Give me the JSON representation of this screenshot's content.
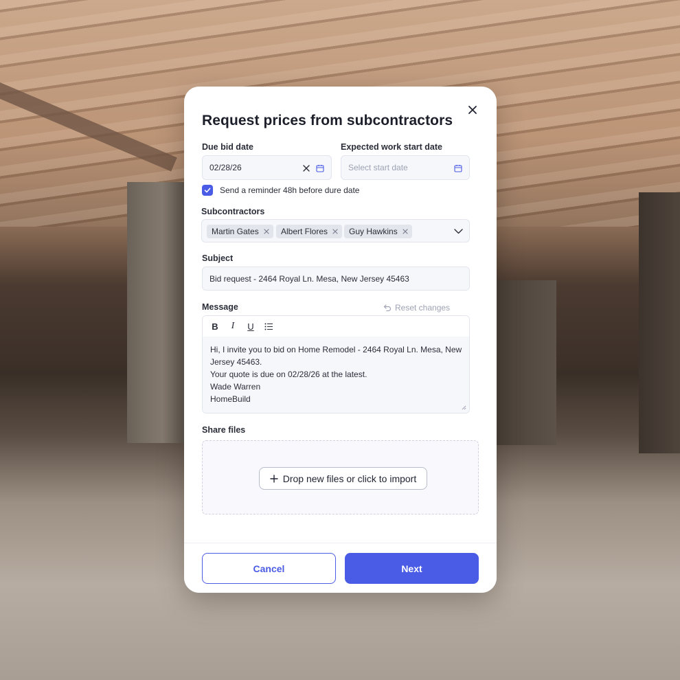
{
  "modal": {
    "title": "Request prices from subcontractors",
    "close_icon": "close-icon"
  },
  "due_bid_date": {
    "label": "Due bid date",
    "value": "02/28/26"
  },
  "work_start_date": {
    "label": "Expected work start date",
    "placeholder": "Select start date"
  },
  "reminder": {
    "label": "Send a reminder 48h before dure date",
    "checked": true
  },
  "subcontractors": {
    "label": "Subcontractors",
    "chips": [
      "Martin Gates",
      "Albert Flores",
      "Guy Hawkins"
    ]
  },
  "subject": {
    "label": "Subject",
    "value": "Bid request - 2464 Royal Ln. Mesa, New Jersey 45463"
  },
  "message": {
    "label": "Message",
    "reset_label": "Reset changes",
    "toolbar": {
      "bold": "B",
      "italic": "I",
      "underline": "U"
    },
    "lines": [
      "Hi, I invite you to bid on Home Remodel - 2464 Royal Ln. Mesa, New",
      "Jersey 45463.",
      "Your quote is due on 02/28/26 at the latest.",
      "Wade Warren",
      "HomeBuild"
    ]
  },
  "share_files": {
    "label": "Share files",
    "import_label": "Drop new files or click to import"
  },
  "footer": {
    "cancel_label": "Cancel",
    "next_label": "Next"
  },
  "colors": {
    "accent": "#4a5be6",
    "field_bg": "#f6f7fb"
  }
}
